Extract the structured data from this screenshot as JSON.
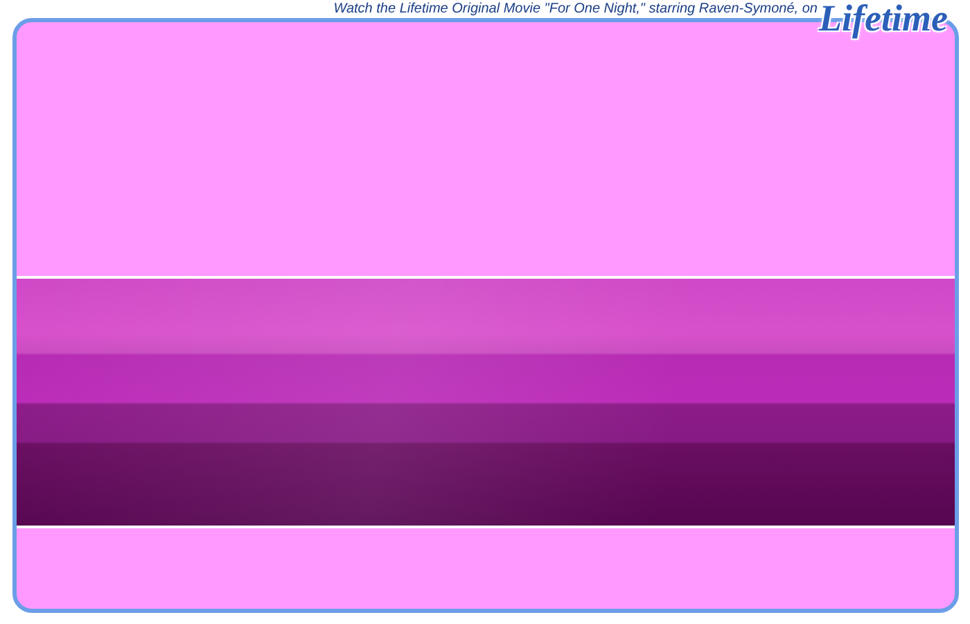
{
  "promo": {
    "text": "Watch the Lifetime Original Movie \"For One Night,\" starring Raven-Symoné, on",
    "logo": "Lifetime"
  }
}
